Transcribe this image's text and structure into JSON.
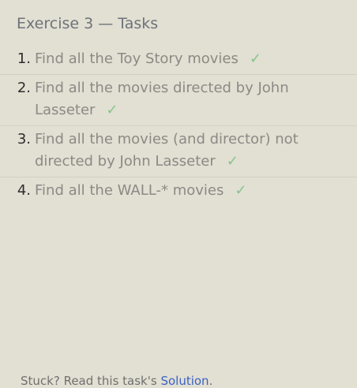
{
  "header": {
    "title": "Exercise 3 — Tasks"
  },
  "tasks": [
    {
      "number": "1.",
      "text": "Find all the Toy Story movies",
      "check": "✓"
    },
    {
      "number": "2.",
      "text": "Find all the movies directed by John Lasseter",
      "check": "✓"
    },
    {
      "number": "3.",
      "text": "Find all the movies (and director) not directed by John Lasseter",
      "check": "✓"
    },
    {
      "number": "4.",
      "text": "Find all the WALL-* movies",
      "check": "✓"
    }
  ],
  "footer": {
    "prefix": "Stuck? Read this task's ",
    "link_label": "Solution",
    "suffix": "."
  },
  "colors": {
    "background": "#e2dfd3",
    "check": "#86c68a",
    "link": "#3b63c4",
    "task_text": "#8b8a85"
  }
}
